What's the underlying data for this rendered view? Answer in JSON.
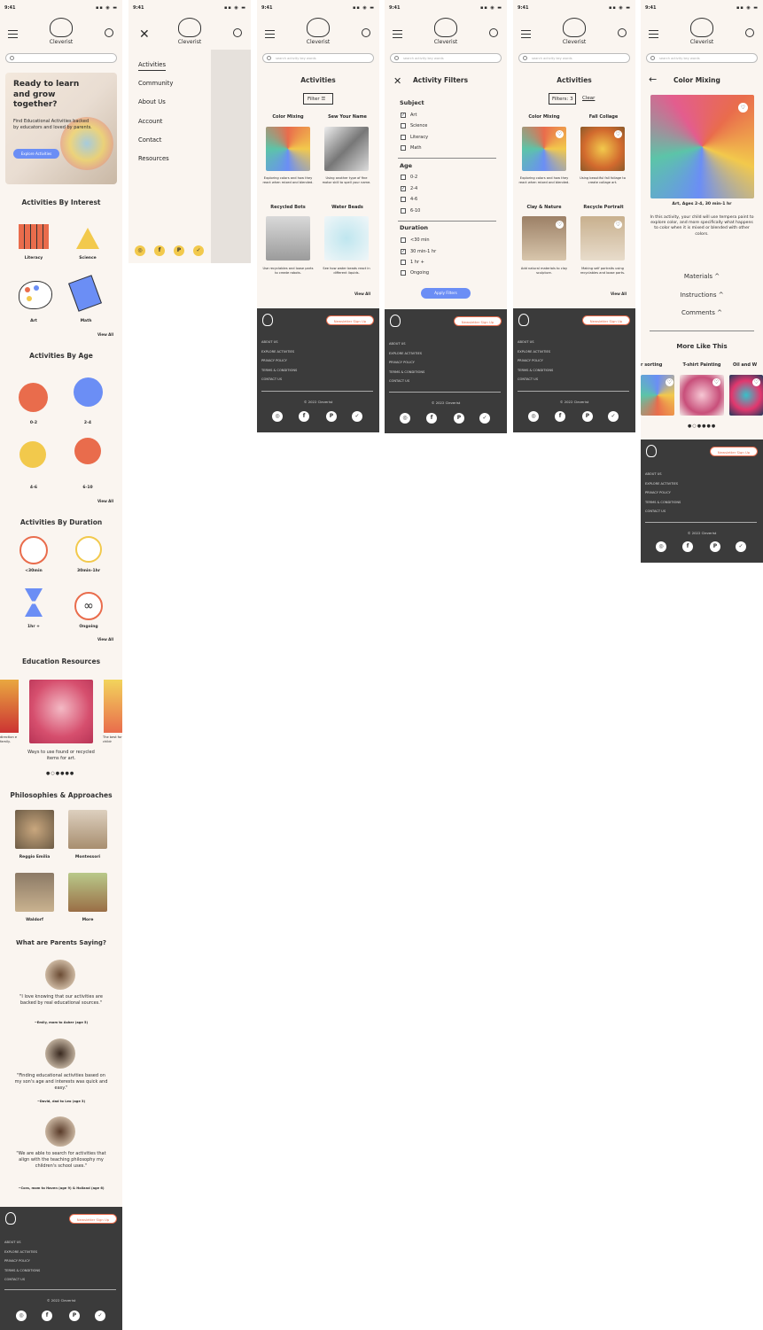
{
  "status": {
    "time": "9:41"
  },
  "brand": "Cleverist",
  "search_placeholder": "search activity key words",
  "home": {
    "hero_title": "Ready to learn and grow together?",
    "hero_sub": "Find Educational Activities backed by educators and loved by parents.",
    "hero_btn": "Explore Activities",
    "interest_title": "Activities By Interest",
    "interests": [
      "Literacy",
      "Science",
      "Art",
      "Math"
    ],
    "age_title": "Activities By Age",
    "ages": [
      "0-2",
      "2-4",
      "4-6",
      "6-10"
    ],
    "duration_title": "Activities By Duration",
    "durations": [
      "<30min",
      "30min-1hr",
      "1hr +",
      "Ongoing"
    ],
    "view_all": "View All",
    "res_title": "Education Resources",
    "res_caption": "Ways to use found or recycled items for art.",
    "res_left": "direction e family.",
    "res_right": "The best for childr",
    "phil_title": "Philosophies & Approaches",
    "phils": [
      "Reggio Emilia",
      "Montessori",
      "Waldorf",
      "More"
    ],
    "parents_title": "What are Parents Saying?",
    "quotes": [
      {
        "q": "\"I love knowing that our activities are backed by real educational sources.\"",
        "a": "~Emily, mom to Asher (age 5)"
      },
      {
        "q": "\"Finding educational activities based on my son's age and interests was quick and easy.\"",
        "a": "~David, dad to Leo  (age 3)"
      },
      {
        "q": "\"We are able to search for activities that align with the teaching philosophy my children's school uses.\"",
        "a": "~Cora, mom to Haven (age 9) & Holland (age 6)"
      }
    ]
  },
  "menu": {
    "items": [
      "Activities",
      "Community",
      "About Us",
      "Account",
      "Contact",
      "Resources"
    ]
  },
  "activities": {
    "title": "Activities",
    "filter": "Filter",
    "filters3": "Filters: 3",
    "clear": "Clear",
    "cards": [
      {
        "t": "Color Mixing",
        "c": "Exploring colors and how they react when mixed and blended."
      },
      {
        "t": "Sew Your Name",
        "c": "Using another type of fine motor skill to spell your name."
      },
      {
        "t": "Recycled Bots",
        "c": "Use recyclables and loose parts to create robots."
      },
      {
        "t": "Water Beads",
        "c": "See how water beads react in different liquids."
      }
    ],
    "cards2": [
      {
        "t": "Color Mixing",
        "c": "Exploring colors and how they react when mixed and blended."
      },
      {
        "t": "Fall Collage",
        "c": "Using beautiful fall foliage to create collage art."
      },
      {
        "t": "Clay & Nature",
        "c": "Add natural materials to clay sculpture."
      },
      {
        "t": "Recycle Portrait",
        "c": "Making self portraits using recyclables and loose parts."
      }
    ]
  },
  "filters": {
    "title": "Activity Filters",
    "subject": "Subject",
    "subjects": [
      "Art",
      "Science",
      "Literacy",
      "Math"
    ],
    "age": "Age",
    "ages": [
      "0-2",
      "2-4",
      "4-6",
      "6-10"
    ],
    "duration": "Duration",
    "durations": [
      "<30 min",
      "30 min-1 hr",
      "1 hr +",
      "Ongoing"
    ],
    "apply": "Apply Filters"
  },
  "detail": {
    "title": "Color Mixing",
    "meta": "Art, Ages 2-4, 30 min-1 hr",
    "desc": "In this activity, your child will use tempera paint to explore color, and more specifically what happens to color when it is mixed or blended with other colors.",
    "materials": "Materials",
    "instructions": "Instructions",
    "comments": "Comments",
    "more": "More Like This",
    "more_items": [
      "r sorting",
      "T-shirt Painting",
      "Oil and W"
    ]
  },
  "footer": {
    "newsletter": "Newsletter Sign Up",
    "links": [
      "ABOUT US",
      "EXPLORE ACTIVITIES",
      "PRIVACY POLICY",
      "TERMS & CONDITIONS",
      "CONTACT US"
    ],
    "copyright": "© 2022 Cleverist"
  },
  "colors": {
    "accent": "#e96c4c",
    "blue": "#6b8ef5",
    "dark": "#3b3b3b",
    "bg": "#faf5f0"
  }
}
